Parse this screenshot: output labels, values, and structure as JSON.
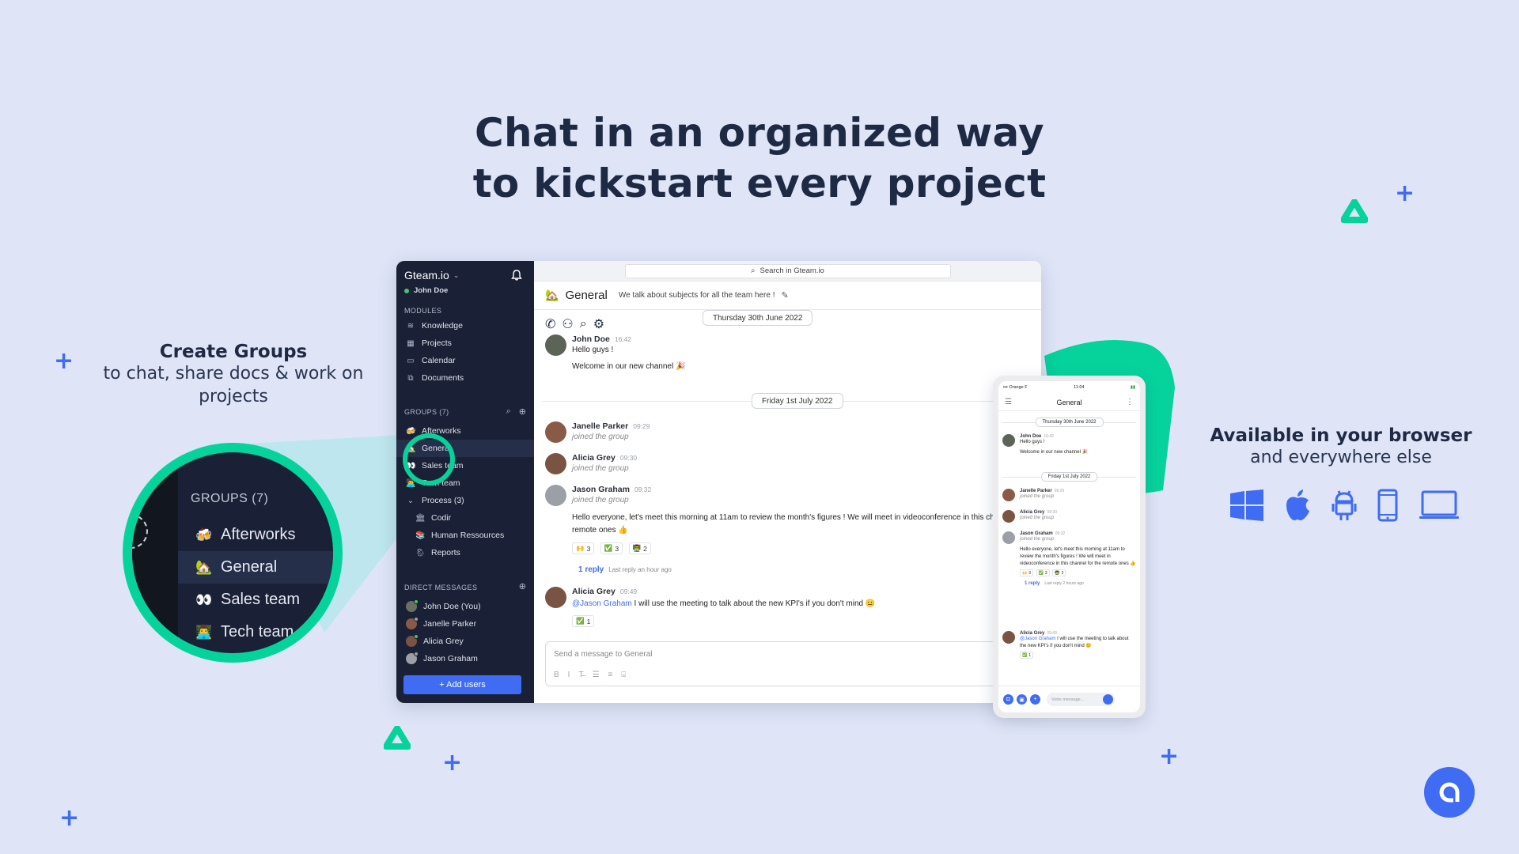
{
  "headline": {
    "line1": "Chat in an organized way",
    "line2": "to kickstart every project"
  },
  "left_callout": {
    "title": "Create Groups",
    "subtitle": "to chat, share docs & work on projects"
  },
  "right_callout": {
    "title": "Available in your browser",
    "subtitle": "and everywhere else",
    "platforms": [
      "windows-icon",
      "apple-icon",
      "android-icon",
      "smartphone-icon",
      "laptop-icon"
    ]
  },
  "colors": {
    "background": "#dfe5f7",
    "accent_blue": "#3f6cf3",
    "accent_green": "#06d39c",
    "sidebar": "#1a2035",
    "text_dark": "#1e2a44"
  },
  "zoom_callout": {
    "header": "GROUPS (7)",
    "items": [
      {
        "emoji": "🍻",
        "label": "Afterworks",
        "active": false
      },
      {
        "emoji": "🏡",
        "label": "General",
        "active": true
      },
      {
        "emoji": "👀",
        "label": "Sales team",
        "active": false
      },
      {
        "emoji": "👨‍💻",
        "label": "Tech team",
        "active": false
      }
    ]
  },
  "app": {
    "workspace": "Gteam.io",
    "user": "John Doe",
    "modules_header": "MODULES",
    "modules": [
      {
        "icon": "knowledge-icon",
        "glyph": "≋",
        "label": "Knowledge"
      },
      {
        "icon": "projects-icon",
        "glyph": "▦",
        "label": "Projects"
      },
      {
        "icon": "calendar-icon",
        "glyph": "▭",
        "label": "Calendar"
      },
      {
        "icon": "documents-icon",
        "glyph": "⧉",
        "label": "Documents"
      }
    ],
    "groups_header": "GROUPS (7)",
    "groups": [
      {
        "emoji": "🍻",
        "label": "Afterworks",
        "active": false
      },
      {
        "emoji": "🏡",
        "label": "General",
        "active": true
      },
      {
        "emoji": "👀",
        "label": "Sales team",
        "active": false
      },
      {
        "emoji": "👨‍💻",
        "label": "Tech team",
        "active": false
      }
    ],
    "folder": {
      "label": "Process (3)",
      "expanded": true
    },
    "subgroups": [
      {
        "emoji": "🏛",
        "label": "Codir"
      },
      {
        "emoji": "📚",
        "label": "Human Ressources"
      },
      {
        "emoji": "🌦",
        "label": "Reports"
      }
    ],
    "dm_header": "DIRECT MESSAGES",
    "dms": [
      {
        "label": "John Doe (You)",
        "avatar": "#6b6f64",
        "status": "#4cc26c"
      },
      {
        "label": "Janelle Parker",
        "avatar": "#8a5a48",
        "status": "#9aa0ab"
      },
      {
        "label": "Alicia Grey",
        "avatar": "#7a5443",
        "status": "#4cc26c"
      },
      {
        "label": "Jason Graham",
        "avatar": "#9b9fa6",
        "status": "#9aa0ab"
      }
    ],
    "add_users": "+ Add users",
    "search_placeholder": "Search in Gteam.io",
    "channel": {
      "emoji": "🏡",
      "name": "General",
      "description": "We talk about subjects for all the team here !"
    },
    "date1": "Thursday 30th June 2022",
    "date2": "Friday 1st July 2022",
    "messages": [
      {
        "author": "John Doe",
        "time": "16:42",
        "lines": [
          "Hello guys !",
          "Welcome in our new channel 🎉"
        ]
      },
      {
        "author": "Janelle Parker",
        "time": "09:29",
        "system": "joined the group"
      },
      {
        "author": "Alicia Grey",
        "time": "09:30",
        "system": "joined the group"
      },
      {
        "author": "Jason Graham",
        "time": "09:32",
        "system": "joined the group",
        "text": "Hello everyone, let's meet this morning at 11am to review the month's figures ! We will meet in videoconference in this channel for the remote ones 👍",
        "reactions": [
          {
            "emoji": "🙌",
            "count": "3"
          },
          {
            "emoji": "✅",
            "count": "3"
          },
          {
            "emoji": "👨‍🏫",
            "count": "2"
          }
        ],
        "reply": "1 reply",
        "reply_meta": "Last reply an hour ago"
      },
      {
        "author": "Alicia Grey",
        "time": "09:49",
        "mention": "@Jason Graham",
        "text": "I will use the meeting to talk about the new KPI's if you don't mind 😐",
        "reactions": [
          {
            "emoji": "✅",
            "count": "1"
          }
        ]
      }
    ],
    "composer_placeholder": "Send a message to General",
    "format_tools": [
      "B",
      "I",
      "T̶",
      "☰",
      "≡",
      "⌸"
    ]
  },
  "phone": {
    "carrier": "Orange F",
    "clock": "11:04",
    "title": "General",
    "date1": "Thursday 30th June 2022",
    "date2": "Friday 1st July 2022",
    "messages": [
      {
        "author": "John Doe",
        "time": "16:42",
        "lines": [
          "Hello guys !",
          "Welcome in our new channel 🎉"
        ]
      },
      {
        "author": "Janelle Parker",
        "time": "09:29",
        "system": "joined the group"
      },
      {
        "author": "Alicia Grey",
        "time": "09:30",
        "system": "joined the group"
      },
      {
        "author": "Jason Graham",
        "time": "09:32",
        "system": "joined the group",
        "text": "Hello everyone, let's meet this morning at 11am to review the month's figures ! We will meet in videoconference in this channel for the remote ones 👍",
        "reactions": [
          {
            "emoji": "🙌",
            "count": "3"
          },
          {
            "emoji": "✅",
            "count": "3"
          },
          {
            "emoji": "👨‍🏫",
            "count": "2"
          }
        ],
        "reply": "1 reply",
        "reply_meta": "Last reply 2 hours ago"
      },
      {
        "author": "Alicia Grey",
        "time": "09:49",
        "mention": "@Jason Graham",
        "text": "I will use the meeting to talk about the new KPI's if you don't mind 😐",
        "reactions": [
          {
            "emoji": "✅",
            "count": "1"
          }
        ]
      }
    ],
    "input_placeholder": "Votre message..."
  }
}
